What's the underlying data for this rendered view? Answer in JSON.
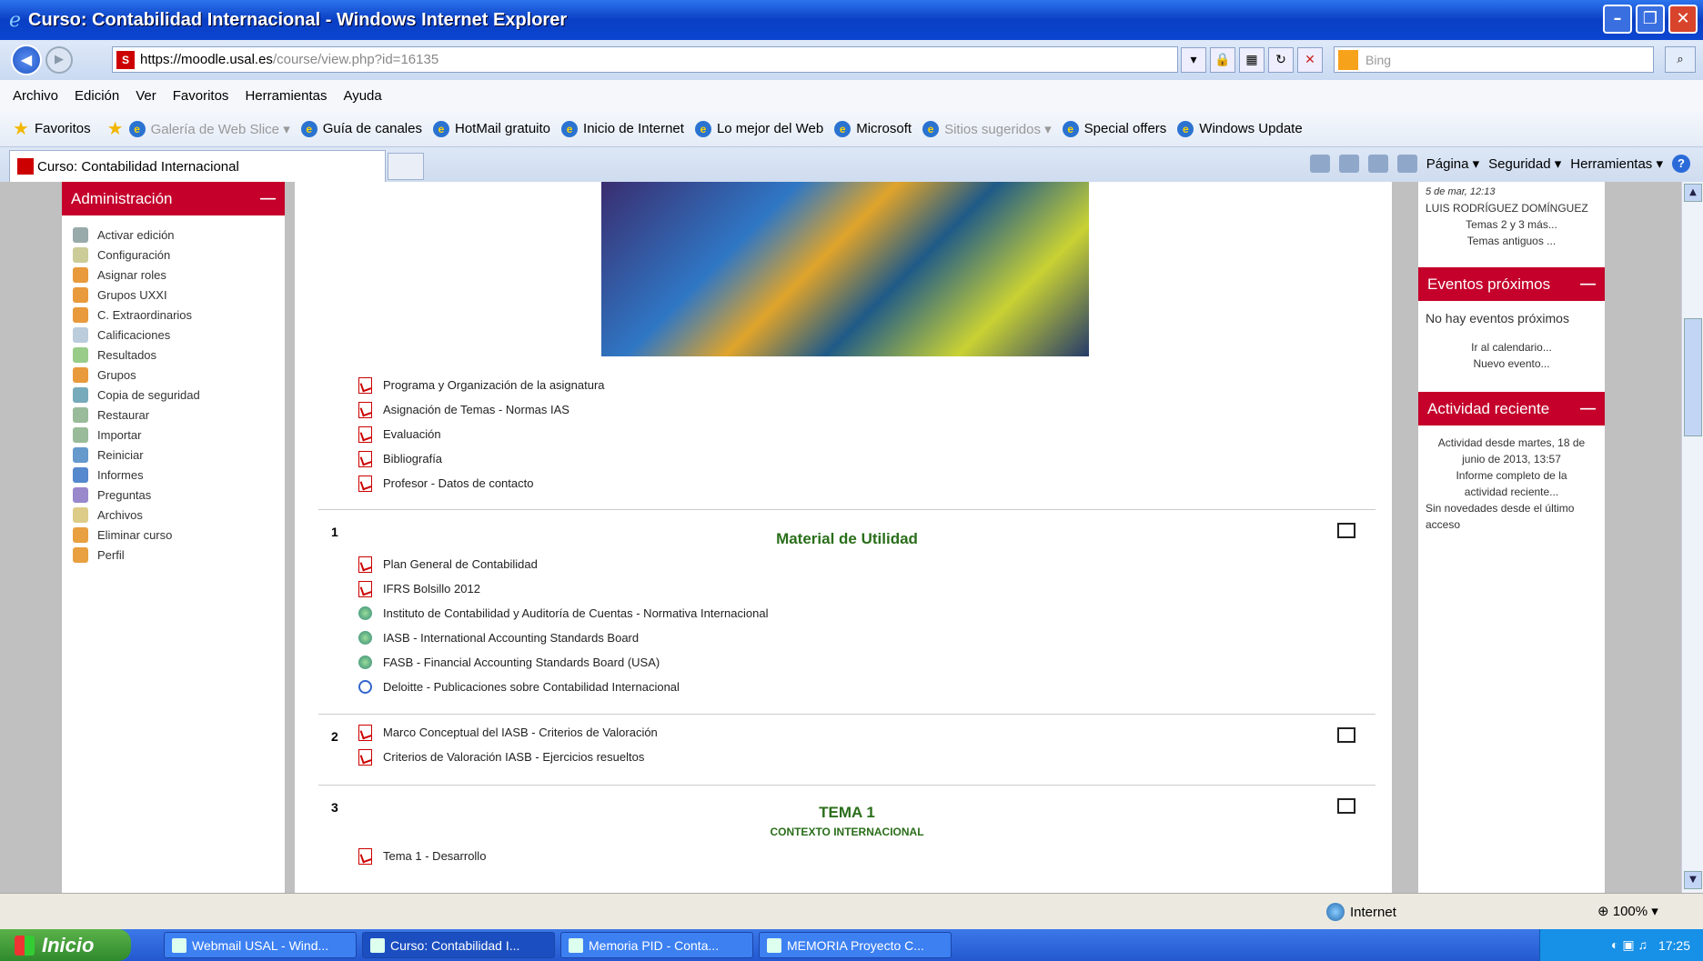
{
  "window": {
    "title": "Curso: Contabilidad Internacional - Windows Internet Explorer"
  },
  "address": {
    "url_prefix": "https://",
    "url_domain": "moodle.usal.es",
    "url_path": "/course/view.php?id=16135",
    "search_placeholder": "Bing"
  },
  "menu": [
    "Archivo",
    "Edición",
    "Ver",
    "Favoritos",
    "Herramientas",
    "Ayuda"
  ],
  "favorites": {
    "label": "Favoritos",
    "items": [
      {
        "label": "Galería de Web Slice ▾",
        "dim": true
      },
      {
        "label": "Guía de canales",
        "dim": false
      },
      {
        "label": "HotMail gratuito",
        "dim": false
      },
      {
        "label": "Inicio de Internet",
        "dim": false
      },
      {
        "label": "Lo mejor del Web",
        "dim": false
      },
      {
        "label": "Microsoft",
        "dim": false
      },
      {
        "label": "Sitios sugeridos ▾",
        "dim": true
      },
      {
        "label": "Special offers",
        "dim": false
      },
      {
        "label": "Windows Update",
        "dim": false
      }
    ]
  },
  "tab": {
    "label": "Curso: Contabilidad Internacional"
  },
  "commands": {
    "page": "Página ▾",
    "security": "Seguridad ▾",
    "tools": "Herramientas ▾"
  },
  "admin": {
    "title": "Administración",
    "items": [
      {
        "label": "Activar edición",
        "color": "#9aa"
      },
      {
        "label": "Configuración",
        "color": "#cc9"
      },
      {
        "label": "Asignar roles",
        "color": "#e89a3c"
      },
      {
        "label": "Grupos UXXI",
        "color": "#e89a3c"
      },
      {
        "label": "C. Extraordinarios",
        "color": "#e89a3c"
      },
      {
        "label": "Calificaciones",
        "color": "#bcd"
      },
      {
        "label": "Resultados",
        "color": "#9c8"
      },
      {
        "label": "Grupos",
        "color": "#e89a3c"
      },
      {
        "label": "Copia de seguridad",
        "color": "#7ab"
      },
      {
        "label": "Restaurar",
        "color": "#9b9"
      },
      {
        "label": "Importar",
        "color": "#9b9"
      },
      {
        "label": "Reiniciar",
        "color": "#69c"
      },
      {
        "label": "Informes",
        "color": "#58c"
      },
      {
        "label": "Preguntas",
        "color": "#98c"
      },
      {
        "label": "Archivos",
        "color": "#dc8"
      },
      {
        "label": "Eliminar curso",
        "color": "#e8a040"
      },
      {
        "label": "Perfil",
        "color": "#e8a040"
      }
    ]
  },
  "section0": {
    "resources": [
      "Programa y Organización de la asignatura",
      "Asignación de Temas - Normas IAS",
      "Evaluación",
      "Bibliografía",
      "Profesor - Datos de contacto"
    ]
  },
  "section1": {
    "num": "1",
    "title": "Material de Utilidad",
    "resources": [
      {
        "label": "Plan General de Contabilidad",
        "icon": "pdf"
      },
      {
        "label": "IFRS Bolsillo 2012",
        "icon": "pdf"
      },
      {
        "label": "Instituto de Contabilidad y Auditoría de Cuentas - Normativa Internacional",
        "icon": "globe"
      },
      {
        "label": "IASB - International Accounting Standards Board",
        "icon": "globe"
      },
      {
        "label": "FASB - Financial Accounting Standards Board (USA)",
        "icon": "globe"
      },
      {
        "label": "Deloitte - Publicaciones sobre Contabilidad Internacional",
        "icon": "link"
      }
    ]
  },
  "section2": {
    "num": "2",
    "resources": [
      "Marco Conceptual del IASB - Criterios de Valoración",
      "Criterios de Valoración IASB - Ejercicios resueltos"
    ]
  },
  "section3": {
    "num": "3",
    "title": "TEMA 1",
    "subtitle": "CONTEXTO INTERNACIONAL",
    "resources": [
      "Tema 1 - Desarrollo"
    ]
  },
  "news": {
    "date": "5 de mar, 12:13",
    "author": "LUIS RODRÍGUEZ DOMÍNGUEZ",
    "item": "Temas 2 y 3 más...",
    "older": "Temas antiguos ..."
  },
  "events": {
    "title": "Eventos próximos",
    "none": "No hay eventos próximos",
    "calendar": "Ir al calendario...",
    "new": "Nuevo evento..."
  },
  "activity": {
    "title": "Actividad reciente",
    "since": "Actividad desde martes, 18 de junio de 2013, 13:57",
    "report": "Informe completo de la actividad reciente...",
    "nonews": "Sin novedades desde el último acceso"
  },
  "status": {
    "zone": "Internet",
    "zoom": "100%"
  },
  "taskbar": {
    "start": "Inicio",
    "tasks": [
      {
        "label": "Webmail USAL - Wind...",
        "active": false
      },
      {
        "label": "Curso: Contabilidad I...",
        "active": true
      },
      {
        "label": "Memoria PID - Conta...",
        "active": false
      },
      {
        "label": "MEMORIA Proyecto C...",
        "active": false
      }
    ],
    "clock": "17:25"
  },
  "colors": {
    "moodle_red": "#c4002b",
    "section_green": "#2a6e1a"
  }
}
